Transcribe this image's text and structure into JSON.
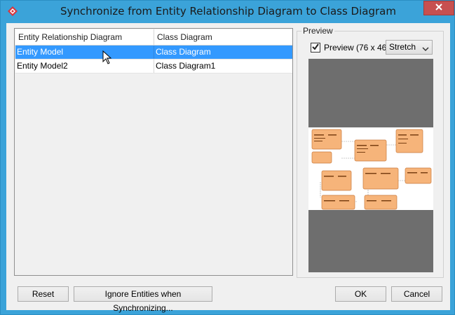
{
  "window": {
    "title": "Synchronize from Entity Relationship Diagram to Class Diagram",
    "close_icon": "close-icon",
    "app_icon": "visual-paradigm-icon"
  },
  "table": {
    "columns": [
      "Entity Relationship Diagram",
      "Class Diagram"
    ],
    "rows": [
      {
        "erd": "Entity Model",
        "class": "Class Diagram",
        "selected": true
      },
      {
        "erd": "Entity Model2",
        "class": "Class Diagram1",
        "selected": false
      }
    ]
  },
  "preview": {
    "group_label": "Preview",
    "checkbox_label": "Preview",
    "checked": true,
    "size_text": "(76 x 46)",
    "mode_selected": "Stretch"
  },
  "buttons": {
    "reset": "Reset",
    "ignore": "Ignore Entities when Synchronizing...",
    "ok": "OK",
    "cancel": "Cancel"
  },
  "colors": {
    "titlebar": "#3ba3d9",
    "close": "#c75050",
    "selection": "#3399ff",
    "entity_fill": "#f6b47a",
    "entity_border": "#c97a3d",
    "canvas_bg": "#6e6e6e"
  }
}
